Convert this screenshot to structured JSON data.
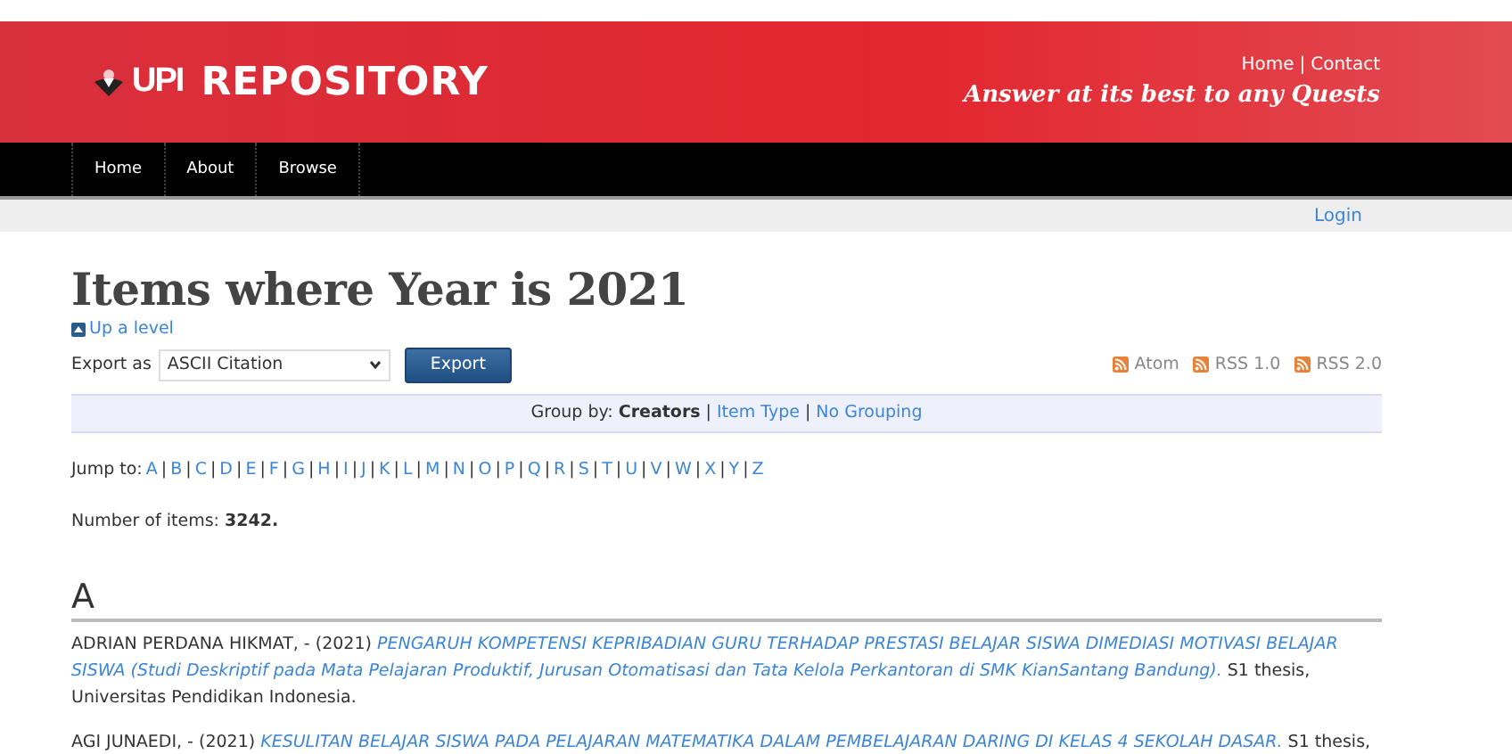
{
  "header": {
    "logo_text": "UPI",
    "site_title": "REPOSITORY",
    "links": [
      "Home",
      "Contact"
    ],
    "link_separator": "|",
    "tagline": "Answer at its best to any Quests"
  },
  "nav": [
    "Home",
    "About",
    "Browse"
  ],
  "login": "Login",
  "page_title": "Items where Year is 2021",
  "up_level": "Up a level",
  "export": {
    "label": "Export as",
    "value": "ASCII Citation",
    "button": "Export"
  },
  "feeds": [
    "Atom",
    "RSS 1.0",
    "RSS 2.0"
  ],
  "group_by": {
    "label": "Group by:",
    "separator": "|",
    "options": [
      {
        "label": "Creators",
        "selected": true
      },
      {
        "label": "Item Type",
        "selected": false
      },
      {
        "label": "No Grouping",
        "selected": false
      }
    ]
  },
  "jump_to": {
    "label": "Jump to:",
    "separator": "|",
    "letters": [
      "A",
      "B",
      "C",
      "D",
      "E",
      "F",
      "G",
      "H",
      "I",
      "J",
      "K",
      "L",
      "M",
      "N",
      "O",
      "P",
      "Q",
      "R",
      "S",
      "T",
      "U",
      "V",
      "W",
      "X",
      "Y",
      "Z"
    ]
  },
  "count": {
    "label": "Number of items:",
    "value": "3242."
  },
  "sections": [
    {
      "heading": "A",
      "items": [
        {
          "author": "ADRIAN PERDANA HIKMAT, - (2021)",
          "title": "PENGARUH KOMPETENSI KEPRIBADIAN GURU TERHADAP PRESTASI BELAJAR SISWA DIMEDIASI MOTIVASI BELAJAR SISWA (Studi Deskriptif pada Mata Pelajaran Produktif, Jurusan Otomatisasi dan Tata Kelola Perkantoran di SMK KianSantang Bandung).",
          "suffix": "S1 thesis, Universitas Pendidikan Indonesia."
        },
        {
          "author": "AGI JUNAEDI, - (2021)",
          "title": "KESULITAN BELAJAR SISWA PADA PELAJARAN MATEMATIKA DALAM PEMBELAJARAN DARING DI KELAS 4 SEKOLAH DASAR.",
          "suffix": "S1 thesis,"
        }
      ]
    }
  ]
}
